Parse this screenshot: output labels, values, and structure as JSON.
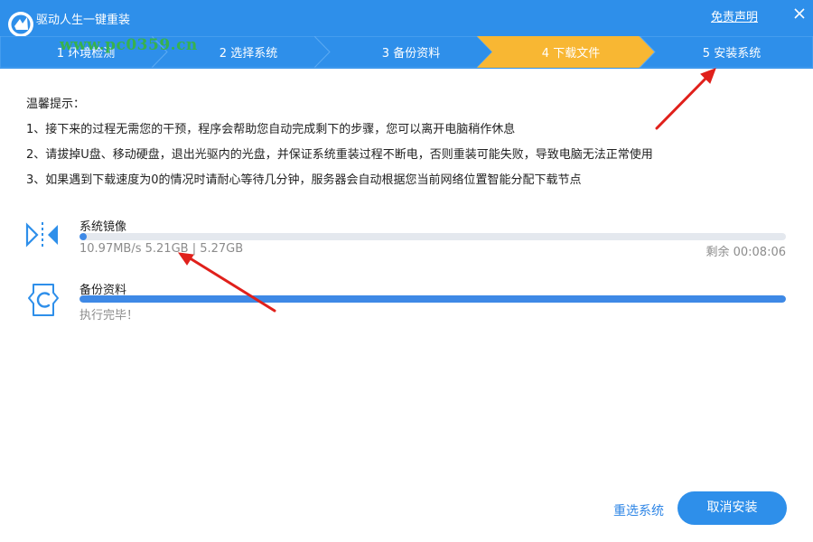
{
  "app": {
    "title": "驱动人生一键重装",
    "watermark": "www.pc0359.cn",
    "disclaimer": "免责声明",
    "colors": {
      "header": "#2e8fea",
      "active_step": "#f8b733",
      "progress": "#3e89e6",
      "watermark": "#37b24d",
      "annotation_arrow": "#e0201b"
    }
  },
  "steps": [
    {
      "label": "1 环境检测",
      "state": "done"
    },
    {
      "label": "2 选择系统",
      "state": "done"
    },
    {
      "label": "3 备份资料",
      "state": "done"
    },
    {
      "label": "4 下载文件",
      "state": "active"
    },
    {
      "label": "5 安装系统",
      "state": "pending"
    }
  ],
  "tips": {
    "heading": "温馨提示：",
    "items": [
      "1、接下来的过程无需您的干预，程序会帮助您自动完成剩下的步骤，您可以离开电脑稍作休息",
      "2、请拔掉U盘、移动硬盘，退出光驱内的光盘，并保证系统重装过程不断电，否则重装可能失败，导致电脑无法正常使用",
      "3、如果遇到下载速度为0的情况时请耐心等待几分钟，服务器会自动根据您当前网络位置智能分配下载节点"
    ]
  },
  "downloads": [
    {
      "name": "系统镜像",
      "icon": "download-arrows-icon",
      "info": "10.97MB/s 5.21GB | 5.27GB",
      "remaining": "剩余 00:08:06",
      "progress_percent": 1
    },
    {
      "name": "备份资料",
      "icon": "backup-c-icon",
      "info": "执行完毕！",
      "remaining": "",
      "progress_percent": 100
    }
  ],
  "buttons": {
    "reselect": "重选系统",
    "cancel": "取消安装"
  }
}
